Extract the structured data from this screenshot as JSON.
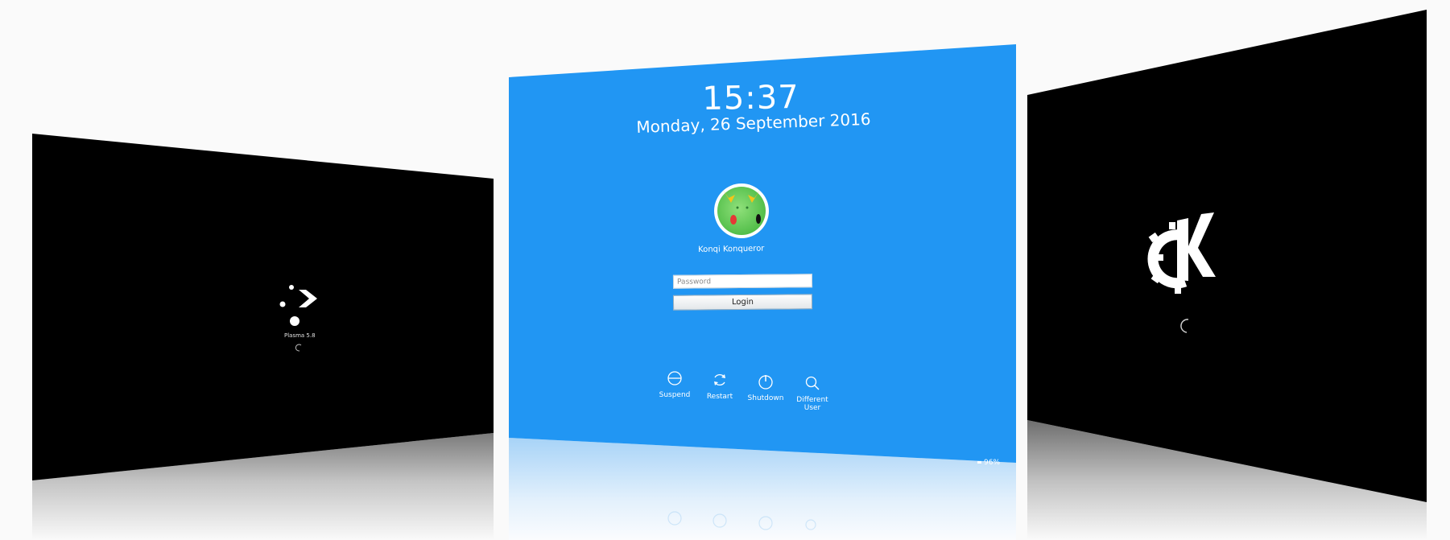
{
  "lockscreen": {
    "time": "15:37",
    "date": "Monday, 26 September 2016",
    "user_name": "Konqi Konqueror",
    "password_placeholder": "Password",
    "login_label": "Login",
    "actions": [
      {
        "label": "Suspend",
        "icon": "suspend-icon"
      },
      {
        "label": "Restart",
        "icon": "restart-icon"
      },
      {
        "label": "Shutdown",
        "icon": "shutdown-icon"
      },
      {
        "label": "Different User",
        "icon": "search-icon"
      }
    ],
    "battery": "96%",
    "background_color": "#2196f3"
  },
  "left_splash": {
    "label": "Plasma 5.8",
    "icon": "plasma-logo-icon",
    "background_color": "#000000"
  },
  "right_splash": {
    "icon": "kde-logo-icon",
    "background_color": "#000000"
  }
}
